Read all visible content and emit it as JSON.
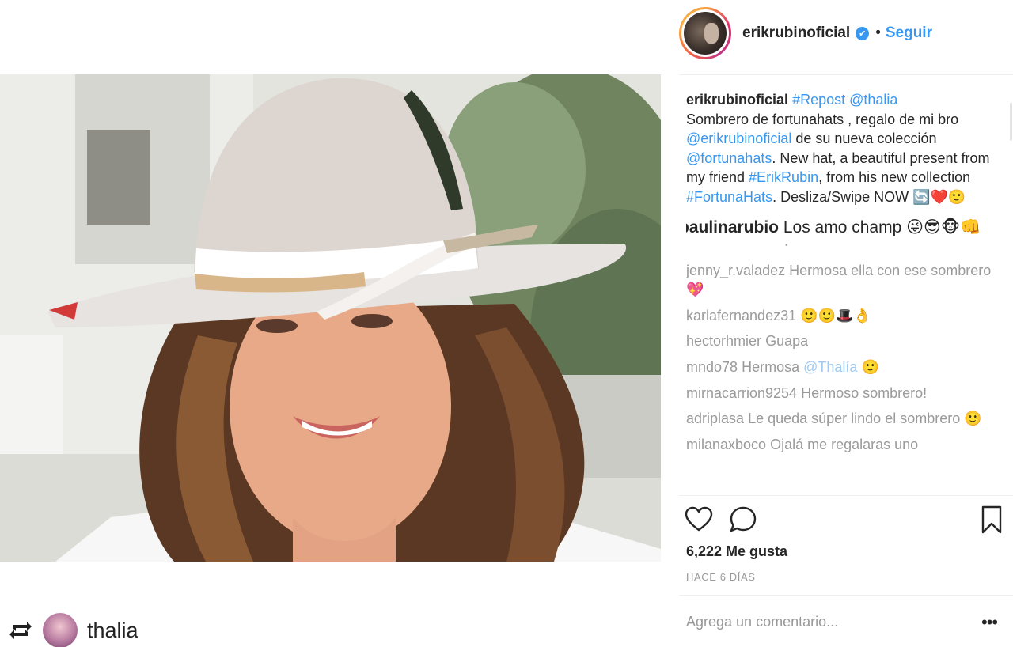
{
  "post": {
    "username": "erikrubinoficial",
    "verified_mark": "✔",
    "separator": "•",
    "follow_label": "Seguir"
  },
  "caption": {
    "username": "erikrubinoficial",
    "tag_repost": "#Repost",
    "mention_thalia": "@thalia",
    "text_1": "Sombrero de fortunahats , regalo de mi bro",
    "mention_erik": "@erikrubinoficial",
    "text_2": "de su nueva colección",
    "mention_fortuna": "@fortunahats",
    "text_3": ". New hat, a beautiful present from my friend",
    "tag_erik": "#ErikRubin",
    "text_4": ", from his new collection",
    "tag_fortuna": "#FortunaHats",
    "text_5": ". Desliza/Swipe NOW 🔄❤️🙂"
  },
  "featured_comment": {
    "username": "paulinarubio",
    "text": "Los amo champ 😜😎🐵👊"
  },
  "separator_dot": "•",
  "comments": [
    {
      "username": "jenny_r.valadez",
      "text": "Hermosa ella con ese sombrero 💖"
    },
    {
      "username": "karlafernandez31",
      "text": "🙂🙂🎩👌"
    },
    {
      "username": "hectorhmier",
      "text": "Guapa"
    },
    {
      "username": "mndo78",
      "text": "Hermosa",
      "mention": "@Thalía",
      "tail": "🙂"
    },
    {
      "username": "mirnacarrion9254",
      "text": "Hermoso sombrero!"
    },
    {
      "username": "adriplasa",
      "text": "Le queda súper lindo el sombrero 🙂"
    },
    {
      "username": "milanaxboco",
      "text": "Ojalá me regalaras uno"
    }
  ],
  "likes_label": "6,222 Me gusta",
  "time_label": "HACE 6 DÍAS",
  "add_comment_placeholder": "Agrega un comentario...",
  "more_label": "•••",
  "repost_user": "thalia",
  "icons": [
    "heart-icon",
    "comment-icon",
    "bookmark-icon",
    "repost-icon",
    "verified-badge-icon",
    "more-options-icon"
  ],
  "colors": {
    "link": "#3897f0",
    "text": "#262626",
    "muted": "#999999"
  }
}
